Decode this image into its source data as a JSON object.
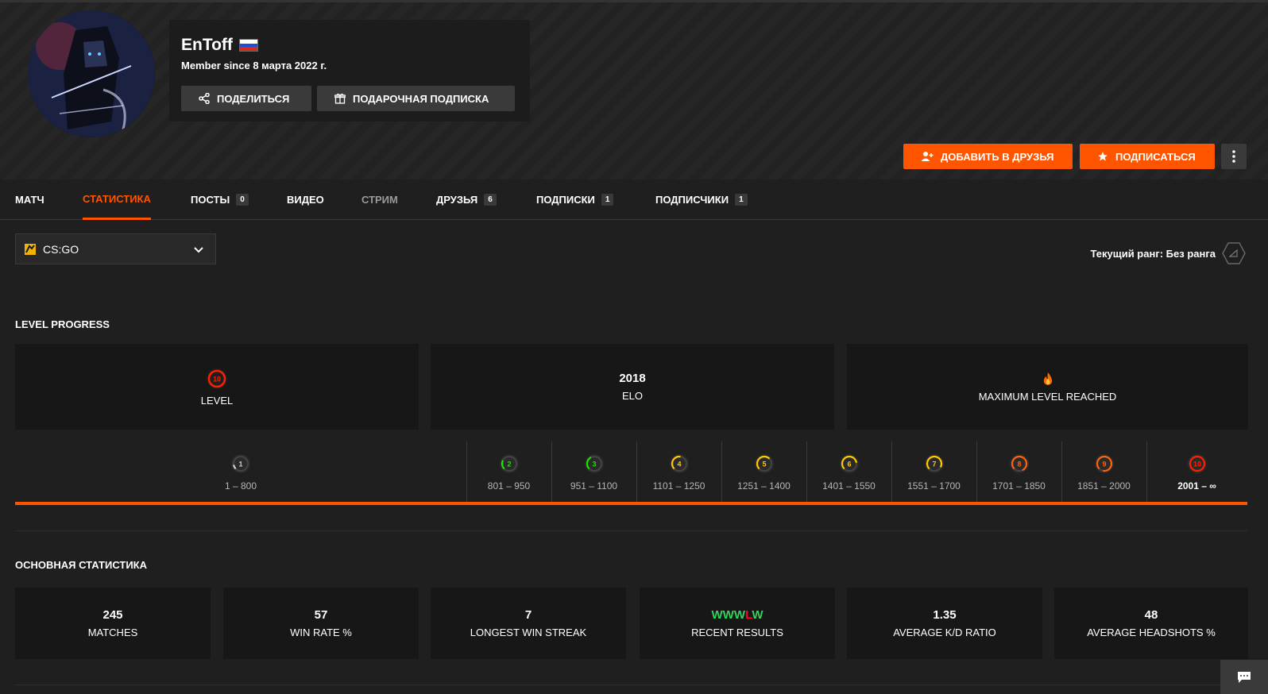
{
  "profile": {
    "username": "EnToff",
    "member_since": "Member since 8 марта 2022 г.",
    "share_label": "ПОДЕЛИТЬСЯ",
    "gift_label": "ПОДАРОЧНАЯ ПОДПИСКА",
    "add_friend_label": "ДОБАВИТЬ В ДРУЗЬЯ",
    "subscribe_label": "ПОДПИСАТЬСЯ",
    "accent": "#ff5500"
  },
  "tabs": [
    {
      "label": "МАТЧ"
    },
    {
      "label": "СТАТИСТИКА"
    },
    {
      "label": "ПОСТЫ",
      "count": "0"
    },
    {
      "label": "ВИДЕО"
    },
    {
      "label": "СТРИМ"
    },
    {
      "label": "ДРУЗЬЯ",
      "count": "6"
    },
    {
      "label": "ПОДПИСКИ",
      "count": "1"
    },
    {
      "label": "ПОДПИСЧИКИ",
      "count": "1"
    }
  ],
  "game_select": {
    "value": "CS:GO"
  },
  "rank": {
    "text": "Текущий ранг: Без ранга"
  },
  "level_progress": {
    "title": "LEVEL PROGRESS",
    "level_value": "10",
    "level_label": "LEVEL",
    "elo_value": "2018",
    "elo_label": "ELO",
    "max_label": "MAXIMUM LEVEL REACHED",
    "levels": [
      {
        "level": "1",
        "range": "1 – 800",
        "color": "#cfcfcf"
      },
      {
        "level": "2",
        "range": "801 – 950",
        "color": "#1ce400"
      },
      {
        "level": "3",
        "range": "951 – 1100",
        "color": "#1ce400"
      },
      {
        "level": "4",
        "range": "1101 – 1250",
        "color": "#ffc800"
      },
      {
        "level": "5",
        "range": "1251 – 1400",
        "color": "#ffc800"
      },
      {
        "level": "6",
        "range": "1401 – 1550",
        "color": "#ffc800"
      },
      {
        "level": "7",
        "range": "1551 – 1700",
        "color": "#ffc800"
      },
      {
        "level": "8",
        "range": "1701 – 1850",
        "color": "#ff6309"
      },
      {
        "level": "9",
        "range": "1851 – 2000",
        "color": "#ff6309"
      },
      {
        "level": "10",
        "range": "2001 – ∞",
        "color": "#fe1f00"
      }
    ],
    "progress": 1.0
  },
  "main_stats": {
    "title": "ОСНОВНАЯ СТАТИСТИКА",
    "items": [
      {
        "value": "245",
        "label": "MATCHES"
      },
      {
        "value": "57",
        "label": "WIN RATE %"
      },
      {
        "value": "7",
        "label": "LONGEST WIN STREAK"
      },
      {
        "value": "WWWLW",
        "label": "RECENT RESULTS"
      },
      {
        "value": "1.35",
        "label": "AVERAGE K/D RATIO"
      },
      {
        "value": "48",
        "label": "AVERAGE HEADSHOTS %"
      }
    ],
    "win_color": "#32d35a",
    "loss_color": "#ff002b"
  }
}
